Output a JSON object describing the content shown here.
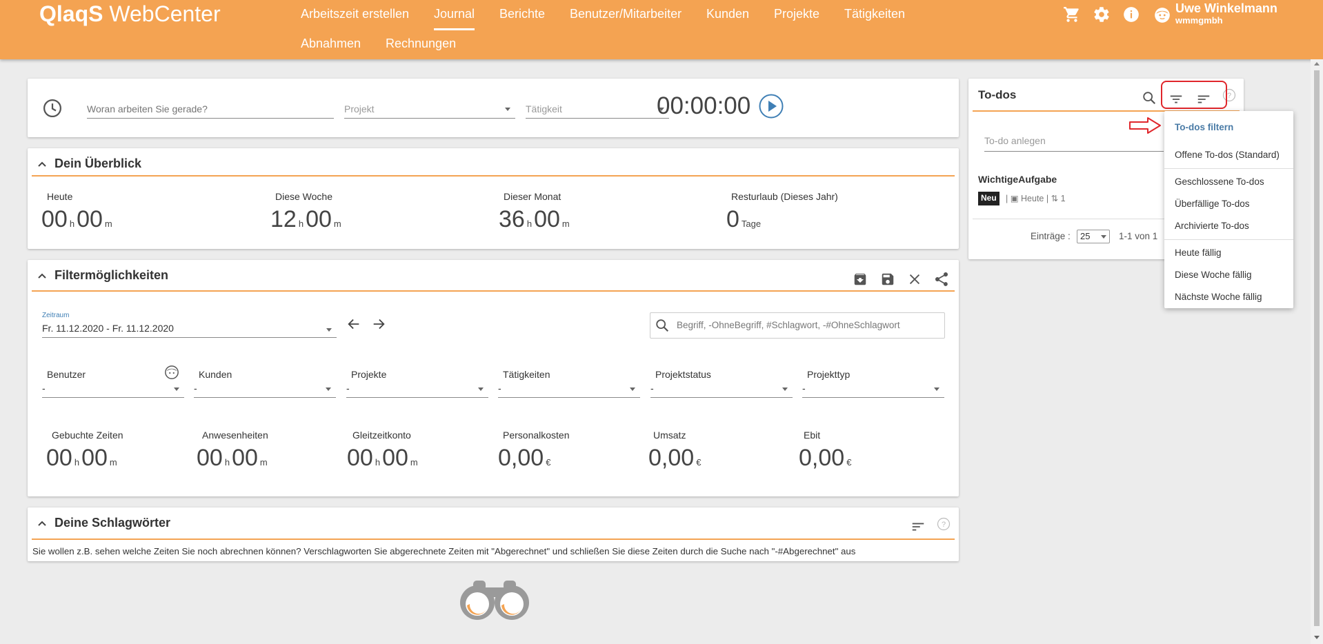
{
  "header": {
    "logo_brand": "QlaqS",
    "logo_product": "WebCenter",
    "nav": [
      {
        "label": "Arbeitszeit erstellen"
      },
      {
        "label": "Journal"
      },
      {
        "label": "Berichte"
      },
      {
        "label": "Benutzer/Mitarbeiter"
      },
      {
        "label": "Kunden"
      },
      {
        "label": "Projekte"
      },
      {
        "label": "Tätigkeiten"
      },
      {
        "label": "Abnahmen"
      },
      {
        "label": "Rechnungen"
      }
    ],
    "active_nav": "Journal",
    "user": {
      "name": "Uwe Winkelmann",
      "company": "wmmgmbh"
    },
    "icons": [
      "cart-icon",
      "gear-icon",
      "info-icon",
      "avatar-icon"
    ]
  },
  "timer": {
    "task_placeholder": "Woran arbeiten Sie gerade?",
    "project_placeholder": "Projekt",
    "activity_placeholder": "Tätigkeit",
    "time": "00:00:00"
  },
  "overview": {
    "title": "Dein Überblick",
    "stats": [
      {
        "label": "Heute",
        "h": "00",
        "m": "00",
        "u1": "h",
        "u2": "m"
      },
      {
        "label": "Diese Woche",
        "h": "12",
        "m": "00",
        "u1": "h",
        "u2": "m"
      },
      {
        "label": "Dieser Monat",
        "h": "36",
        "m": "00",
        "u1": "h",
        "u2": "m"
      },
      {
        "label": "Resturlaub (Dieses Jahr)",
        "value": "0",
        "unit": "Tage"
      }
    ]
  },
  "filters": {
    "title": "Filtermöglichkeiten",
    "period_label": "Zeitraum",
    "period_value": "Fr. 11.12.2020 - Fr. 11.12.2020",
    "search_placeholder": "Begriff, -OhneBegriff, #Schlagwort, -#OhneSchlagwort",
    "selects": [
      {
        "label": "Benutzer",
        "value": "-"
      },
      {
        "label": "Kunden",
        "value": "-"
      },
      {
        "label": "Projekte",
        "value": "-"
      },
      {
        "label": "Tätigkeiten",
        "value": "-"
      },
      {
        "label": "Projektstatus",
        "value": "-"
      },
      {
        "label": "Projekttyp",
        "value": "-"
      }
    ],
    "stats": [
      {
        "label": "Gebuchte Zeiten",
        "h": "00",
        "m": "00",
        "u1": "h",
        "u2": "m"
      },
      {
        "label": "Anwesenheiten",
        "h": "00",
        "m": "00",
        "u1": "h",
        "u2": "m"
      },
      {
        "label": "Gleitzeitkonto",
        "h": "00",
        "m": "00",
        "u1": "h",
        "u2": "m"
      },
      {
        "label": "Personalkosten",
        "value": "0,00",
        "unit": "€"
      },
      {
        "label": "Umsatz",
        "value": "0,00",
        "unit": "€"
      },
      {
        "label": "Ebit",
        "value": "0,00",
        "unit": "€"
      }
    ]
  },
  "tags": {
    "title": "Deine Schlagwörter",
    "hint": "Sie wollen z.B. sehen welche Zeiten Sie noch abrechnen können? Verschlagworten Sie abgerechnete Zeiten mit \"Abgerechnet\" und schließen Sie diese Zeiten durch die Suche nach \"-#Abgerechnet\" aus"
  },
  "todos": {
    "title": "To-dos",
    "new_placeholder": "To-do anlegen",
    "item": {
      "title": "WichtigeAufgabe",
      "badge": "Neu",
      "due": "Heute",
      "subcount": "1"
    },
    "entries_label": "Einträge :",
    "page_size": "25",
    "range": "1-1 von 1",
    "menu": {
      "heading": "To-dos filtern",
      "groups": [
        [
          "Offene To-dos (Standard)"
        ],
        [
          "Geschlossene To-dos",
          "Überfällige To-dos",
          "Archivierte To-dos"
        ],
        [
          "Heute fällig",
          "Diese Woche fällig",
          "Nächste Woche fällig"
        ]
      ]
    }
  },
  "colors": {
    "accent": "#f4a352",
    "header_text": "#ffffff",
    "highlight": "#e0262b",
    "menu_heading": "#4a7ba6"
  }
}
